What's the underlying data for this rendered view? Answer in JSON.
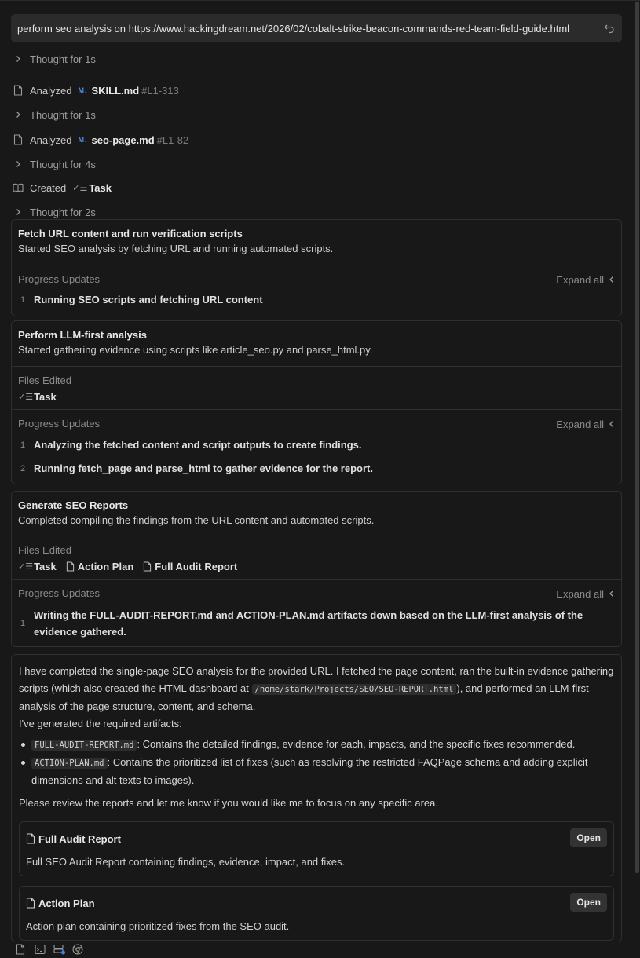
{
  "prompt": {
    "text": "perform seo analysis on https://www.hackingdream.net/2026/02/cobalt-strike-beacon-commands-red-team-field-guide.html"
  },
  "steps": [
    {
      "kind": "thought",
      "text": "Thought for 1s"
    },
    {
      "kind": "analyzed",
      "verb": "Analyzed",
      "badge": "M↓",
      "file": "SKILL.md",
      "lines": "#L1-313"
    },
    {
      "kind": "thought",
      "text": "Thought for 1s"
    },
    {
      "kind": "analyzed",
      "verb": "Analyzed",
      "badge": "M↓",
      "file": "seo-page.md",
      "lines": "#L1-82"
    },
    {
      "kind": "thought",
      "text": "Thought for 4s"
    },
    {
      "kind": "created",
      "verb": "Created",
      "file": "Task"
    },
    {
      "kind": "thought",
      "text": "Thought for 2s"
    }
  ],
  "cards": [
    {
      "title": "Fetch URL content and run verification scripts",
      "subtitle": "Started SEO analysis by fetching URL and running automated scripts.",
      "progress_label": "Progress Updates",
      "expand_label": "Expand all",
      "updates": [
        {
          "num": "1",
          "text": "Running SEO scripts and fetching URL content"
        }
      ]
    },
    {
      "title": "Perform LLM-first analysis",
      "subtitle": "Started gathering evidence using scripts like article_seo.py and parse_html.py.",
      "files_label": "Files Edited",
      "files": [
        "Task"
      ],
      "progress_label": "Progress Updates",
      "expand_label": "Expand all",
      "updates": [
        {
          "num": "1",
          "text": "Analyzing the fetched content and script outputs to create findings."
        },
        {
          "num": "2",
          "text": "Running fetch_page and parse_html to gather evidence for the report."
        }
      ]
    },
    {
      "title": "Generate SEO Reports",
      "subtitle": "Completed compiling the findings from the URL content and automated scripts.",
      "files_label": "Files Edited",
      "files": [
        "Task",
        "Action Plan",
        "Full Audit Report"
      ],
      "progress_label": "Progress Updates",
      "expand_label": "Expand all",
      "updates": [
        {
          "num": "1",
          "text": "Writing the FULL-AUDIT-REPORT.md and ACTION-PLAN.md artifacts down based on the LLM-first analysis of the evidence gathered."
        }
      ]
    }
  ],
  "summary": {
    "p1_a": "I have completed the single-page SEO analysis for the provided URL. I fetched the page content, ran the built-in evidence gathering scripts (which also created the HTML dashboard at ",
    "p1_code": "/home/stark/Projects/SEO/SEO-REPORT.html",
    "p1_b": "), and performed an LLM-first analysis of the page structure, content, and schema.",
    "p2": "I've generated the required artifacts:",
    "bullets": [
      {
        "code": "FULL-AUDIT-REPORT.md",
        "text": ": Contains the detailed findings, evidence for each, impacts, and the specific fixes recommended."
      },
      {
        "code": "ACTION-PLAN.md",
        "text": ": Contains the prioritized list of fixes (such as resolving the restricted FAQPage schema and adding explicit dimensions and alt texts to images)."
      }
    ],
    "p3": "Please review the reports and let me know if you would like me to focus on any specific area.",
    "artifacts": [
      {
        "title": "Full Audit Report",
        "desc": "Full SEO Audit Report containing findings, evidence, impact, and fixes.",
        "button": "Open"
      },
      {
        "title": "Action Plan",
        "desc": "Action plan containing prioritized fixes from the SEO audit.",
        "button": "Open"
      }
    ]
  },
  "bottom_icons": [
    "file-icon",
    "terminal-icon",
    "database-icon",
    "browser-icon"
  ],
  "colors": {
    "background": "#181818",
    "md_badge": "#4d8ee8",
    "border": "#2f2f2f"
  }
}
